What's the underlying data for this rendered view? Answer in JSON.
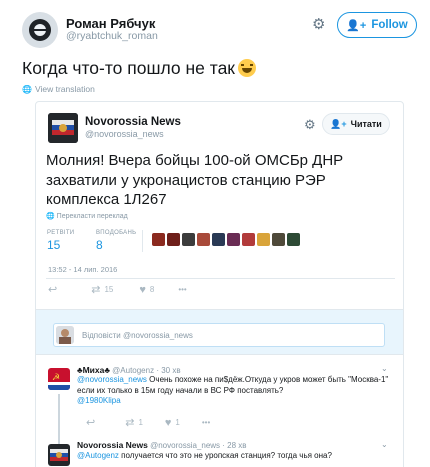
{
  "tweet": {
    "author_name": "Роман Рябчук",
    "author_handle": "@ryabtchuk_roman",
    "follow_label": "Follow",
    "text": "Когда что-то пошло не так",
    "view_translation": "View translation"
  },
  "quoted": {
    "author_name": "Novorossia News",
    "author_handle": "@novorossia_news",
    "follow_label": "Читати",
    "text": "Молния! Вчера бойцы 100-ой ОМСБр ДНР захватили у укронацистов станцию РЭР комплекса 1Л267",
    "translate_label": "Перекласти переклад",
    "retweets_label": "РЕТВІТИ",
    "retweets_value": "15",
    "likes_label": "ВПОДОБАНЬ",
    "likes_value": "8",
    "timestamp": "13:52 - 14 лип. 2016",
    "actions": {
      "retweet_count": "15",
      "like_count": "8",
      "more": "•••"
    },
    "liker_colors": [
      "#8b2a1f",
      "#6e1f1a",
      "#3c3c3c",
      "#a84a3a",
      "#2a3a55",
      "#6a2c54",
      "#b23b3b",
      "#d9a43a",
      "#4f4a3a",
      "#2d4a35"
    ]
  },
  "reply_box": {
    "placeholder": "Відповісти @novorossia_news"
  },
  "replies": [
    {
      "name": "♣Миха♣",
      "handle": "@Autogenz",
      "time": "· 30 хв",
      "mention": "@novorossia_news",
      "text": "Очень похоже на пи$дёж.Откуда у укров может быть \"Москва-1\" если их только в 15м году начали в ВС РФ поставлять?",
      "extra_mention": "@1980Klipa",
      "retweet_count": "1",
      "like_count": "1",
      "more": "•••"
    },
    {
      "name": "Novorossia News",
      "handle": "@novorossia_news",
      "time": "· 28 хв",
      "mention": "@Autogenz",
      "text": "получается что это не уропская станция? тогда чья она?"
    }
  ]
}
